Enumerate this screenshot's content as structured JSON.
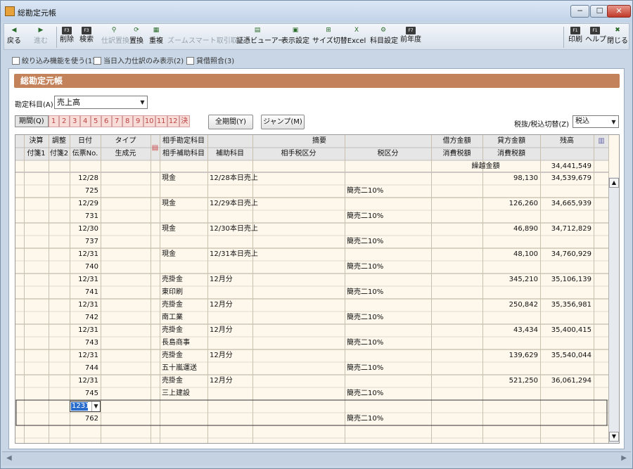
{
  "window": {
    "title": "総勘定元帳"
  },
  "window_buttons": [
    "─",
    "☐",
    "✕"
  ],
  "toolbar": [
    {
      "name": "back-button",
      "label": "戻る",
      "icon": "◀",
      "enabled": true,
      "fkey": ""
    },
    {
      "name": "forward-button",
      "label": "進む",
      "icon": "▶",
      "enabled": false,
      "fkey": ""
    },
    {
      "name": "delete-button",
      "label": "削除",
      "icon": "",
      "enabled": true,
      "fkey": "F3"
    },
    {
      "name": "search-button",
      "label": "検索",
      "icon": "",
      "enabled": true,
      "fkey": "F3"
    },
    {
      "name": "bulk-replace-button",
      "label": "仕訳置換",
      "icon": "⚲",
      "enabled": false,
      "fkey": ""
    },
    {
      "name": "replace-button",
      "label": "置換",
      "icon": "⟳",
      "enabled": true,
      "fkey": ""
    },
    {
      "name": "duplicate-button",
      "label": "重複",
      "icon": "▦",
      "enabled": true,
      "fkey": ""
    },
    {
      "name": "zoom-button",
      "label": "ズーム",
      "icon": "",
      "enabled": false,
      "fkey": ""
    },
    {
      "name": "smart-journal-button",
      "label": "スマート取引取込",
      "icon": "",
      "enabled": false,
      "fkey": ""
    },
    {
      "name": "voucher-viewer-button",
      "label": "証憑ビューアー",
      "icon": "▤",
      "enabled": true,
      "fkey": ""
    },
    {
      "name": "display-settings-button",
      "label": "表示設定",
      "icon": "▣",
      "enabled": true,
      "fkey": ""
    },
    {
      "name": "size-toggle-button",
      "label": "サイズ切替",
      "icon": "⊞",
      "enabled": true,
      "fkey": ""
    },
    {
      "name": "excel-button",
      "label": "Excel",
      "icon": "X",
      "enabled": true,
      "fkey": ""
    },
    {
      "name": "account-settings-button",
      "label": "科目設定",
      "icon": "⚙",
      "enabled": true,
      "fkey": ""
    },
    {
      "name": "prior-year-button",
      "label": "前年度",
      "icon": "",
      "enabled": true,
      "fkey": "F7"
    },
    {
      "name": "print-button",
      "label": "印刷",
      "icon": "",
      "enabled": true,
      "fkey": "F1"
    },
    {
      "name": "help-button",
      "label": "ヘルプ",
      "icon": "",
      "enabled": true,
      "fkey": "F1"
    },
    {
      "name": "close-button",
      "label": "閉じる",
      "icon": "✖",
      "enabled": true,
      "fkey": ""
    }
  ],
  "options": [
    {
      "label": "絞り込み機能を使う(1)"
    },
    {
      "label": "当日入力仕訳のみ表示(2)"
    },
    {
      "label": "貸借照合(3)"
    }
  ],
  "panel_title": "総勘定元帳",
  "account": {
    "label": "勘定科目(A)",
    "value": "売上高"
  },
  "period": {
    "label": "期間(Q)",
    "months": [
      "1",
      "2",
      "3",
      "4",
      "5",
      "6",
      "7",
      "8",
      "9",
      "10",
      "11",
      "12",
      "決"
    ]
  },
  "buttons": {
    "all_period": "全期間(Y)",
    "jump": "ジャンプ(M)"
  },
  "tax": {
    "label": "税抜/税込切替(Z)",
    "value": "税込"
  },
  "headers": {
    "row1": [
      "決算",
      "調整",
      "日付",
      "タイプ",
      "相手勘定科目",
      "摘要",
      "借方金額",
      "貸方金額",
      "残高"
    ],
    "row2": [
      "付箋1",
      "付箋2",
      "伝票No.",
      "生成元",
      "相手補助科目",
      "補助科目",
      "相手税区分",
      "税区分",
      "消費税額",
      "消費税額"
    ],
    "carry_label": "繰越金額",
    "carry_value": "34,441,549"
  },
  "rows": [
    {
      "date": "12/28",
      "voucher": "725",
      "account": "現金",
      "sub": "",
      "memo": "12/28本日売上",
      "tax": "簡売二10%",
      "credit": "98,130",
      "balance": "34,539,679"
    },
    {
      "date": "12/29",
      "voucher": "731",
      "account": "現金",
      "sub": "",
      "memo": "12/29本日売上",
      "tax": "簡売二10%",
      "credit": "126,260",
      "balance": "34,665,939"
    },
    {
      "date": "12/30",
      "voucher": "737",
      "account": "現金",
      "sub": "",
      "memo": "12/30本日売上",
      "tax": "簡売二10%",
      "credit": "46,890",
      "balance": "34,712,829"
    },
    {
      "date": "12/31",
      "voucher": "740",
      "account": "現金",
      "sub": "",
      "memo": "12/31本日売上",
      "tax": "簡売二10%",
      "credit": "48,100",
      "balance": "34,760,929"
    },
    {
      "date": "12/31",
      "voucher": "741",
      "account": "売掛金",
      "sub": "東印刷",
      "memo": "12月分",
      "tax": "簡売二10%",
      "credit": "345,210",
      "balance": "35,106,139"
    },
    {
      "date": "12/31",
      "voucher": "742",
      "account": "売掛金",
      "sub": "南工業",
      "memo": "12月分",
      "tax": "簡売二10%",
      "credit": "250,842",
      "balance": "35,356,981"
    },
    {
      "date": "12/31",
      "voucher": "743",
      "account": "売掛金",
      "sub": "長島商事",
      "memo": "12月分",
      "tax": "簡売二10%",
      "credit": "43,434",
      "balance": "35,400,415"
    },
    {
      "date": "12/31",
      "voucher": "744",
      "account": "売掛金",
      "sub": "五十嵐運送",
      "memo": "12月分",
      "tax": "簡売二10%",
      "credit": "139,629",
      "balance": "35,540,044"
    },
    {
      "date": "12/31",
      "voucher": "745",
      "account": "売掛金",
      "sub": "三上建設",
      "memo": "12月分",
      "tax": "簡売二10%",
      "credit": "521,250",
      "balance": "36,061,294"
    }
  ],
  "edit_row": {
    "date": "1231",
    "voucher": "762",
    "tax": "簡売二10%"
  },
  "colors": {
    "header_bar": "#c4825a",
    "grid_bg": "#fdf7ec",
    "selection": "#2a6ccc"
  }
}
